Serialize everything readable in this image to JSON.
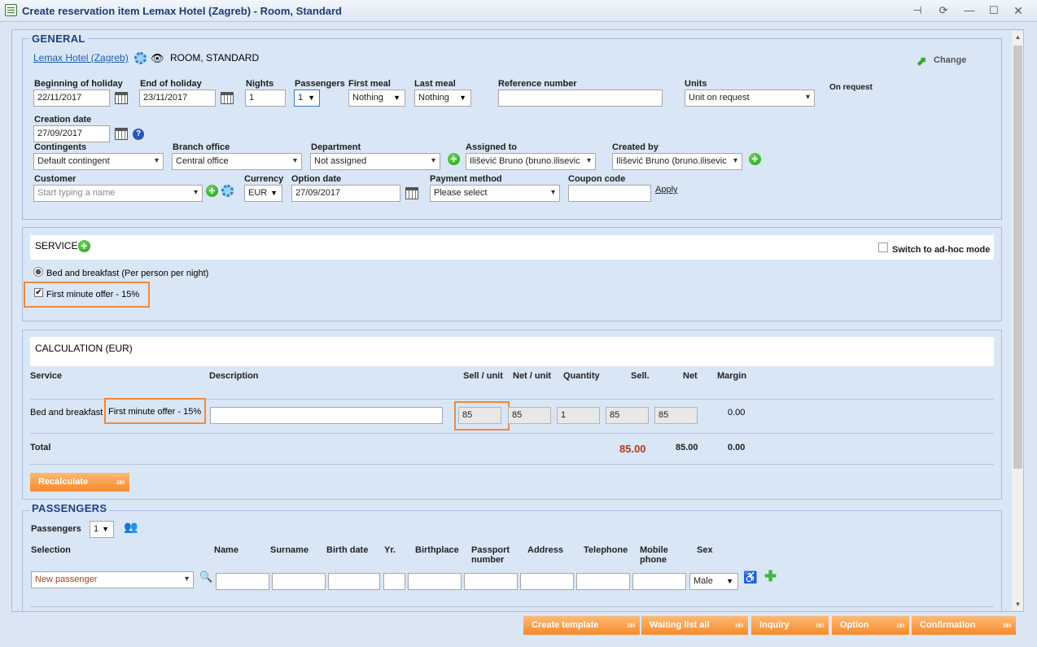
{
  "window": {
    "title": "Create reservation item Lemax Hotel (Zagreb) - Room, Standard",
    "controls": [
      "pin",
      "restore",
      "minimize",
      "maximize",
      "close"
    ]
  },
  "general": {
    "legend": "GENERAL",
    "hotel_link": "Lemax Hotel (Zagreb)",
    "room_type": "ROOM, STANDARD",
    "change_label": "Change",
    "beginning_label": "Beginning of holiday",
    "beginning_value": "22/11/2017",
    "end_label": "End of holiday",
    "end_value": "23/11/2017",
    "nights_label": "Nights",
    "nights_value": "1",
    "passengers_label": "Passengers",
    "passengers_value": "1",
    "first_meal_label": "First meal",
    "first_meal_value": "Nothing",
    "last_meal_label": "Last meal",
    "last_meal_value": "Nothing",
    "reference_label": "Reference number",
    "reference_value": "",
    "units_label": "Units",
    "units_value": "Unit on request",
    "on_request_label": "On request",
    "creation_date_label": "Creation date",
    "creation_date_value": "27/09/2017",
    "contingents_label": "Contingents",
    "contingents_value": "Default contingent",
    "branch_label": "Branch office",
    "branch_value": "Central office",
    "department_label": "Department",
    "department_value": "Not assigned",
    "assigned_label": "Assigned to",
    "assigned_value": "Ilišević Bruno (bruno.ilisevic",
    "created_by_label": "Created by",
    "created_by_value": "Ilišević Bruno (bruno.ilisevic",
    "customer_label": "Customer",
    "customer_placeholder": "Start typing a name",
    "currency_label": "Currency",
    "currency_value": "EUR",
    "option_date_label": "Option date",
    "option_date_value": "27/09/2017",
    "payment_label": "Payment method",
    "payment_value": "Please select",
    "coupon_label": "Coupon code",
    "coupon_value": "",
    "apply_label": "Apply"
  },
  "services": {
    "title": "SERVICES",
    "adhoc_label": "Switch to ad-hoc mode",
    "option_label": "Bed and breakfast (Per person per night)",
    "offer_label": "First minute offer - 15%"
  },
  "calculation": {
    "title": "CALCULATION (EUR)",
    "headers": {
      "service": "Service",
      "description": "Description",
      "sell_unit": "Sell / unit",
      "net_unit": "Net / unit",
      "quantity": "Quantity",
      "sell": "Sell.",
      "net": "Net",
      "margin": "Margin"
    },
    "row": {
      "service": "Bed and breakfast",
      "offer": "First minute offer - 15%",
      "description": "",
      "sell_unit": "85",
      "net_unit": "85",
      "quantity": "1",
      "sell": "85",
      "net": "85",
      "margin": "0.00"
    },
    "total": {
      "label": "Total",
      "sell": "85.00",
      "net": "85.00",
      "margin": "0.00"
    },
    "recalculate_label": "Recalculate"
  },
  "passengers": {
    "legend": "PASSENGERS",
    "count_label": "Passengers",
    "count_value": "1",
    "headers": {
      "selection": "Selection",
      "name": "Name",
      "surname": "Surname",
      "birth_date": "Birth date",
      "yr": "Yr.",
      "birthplace": "Birthplace",
      "passport_l1": "Passport",
      "passport_l2": "number",
      "address": "Address",
      "telephone": "Telephone",
      "mobile_l1": "Mobile",
      "mobile_l2": "phone",
      "sex": "Sex"
    },
    "selection_value": "New passenger",
    "sex_value": "Male"
  },
  "footer": {
    "create_template": "Create template",
    "waiting_list_all": "Waiting list all",
    "inquiry": "Inquiry",
    "option": "Option",
    "confirmation": "Confirmation"
  },
  "colors": {
    "accent_orange": "#f68a2c",
    "link_blue": "#1f5cb0",
    "total_red": "#b03a1c",
    "plus_green": "#1d9b18"
  }
}
